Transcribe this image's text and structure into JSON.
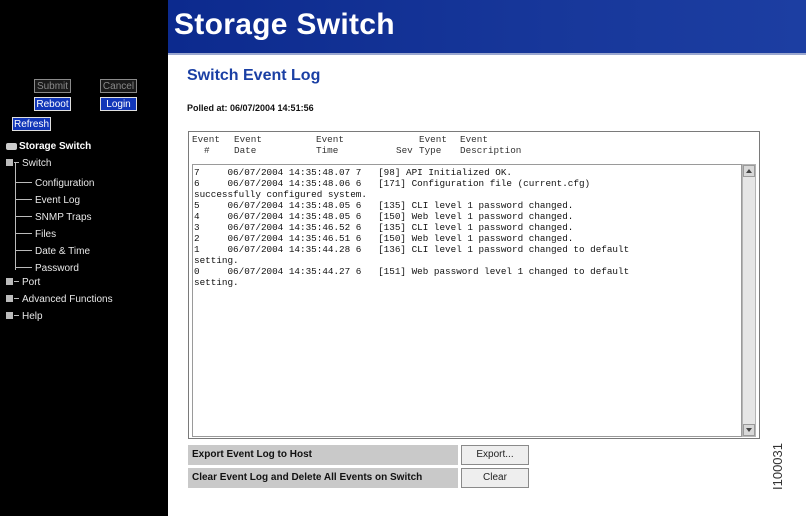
{
  "app": {
    "title": "Storage Switch"
  },
  "sidebar": {
    "buttons": {
      "submit": "Submit",
      "cancel": "Cancel",
      "reboot": "Reboot",
      "login": "Login",
      "refresh": "Refresh"
    },
    "tree": {
      "root": "Storage Switch",
      "switch": "Switch",
      "switch_children": [
        "Configuration",
        "Event Log",
        "SNMP Traps",
        "Files",
        "Date & Time",
        "Password"
      ],
      "port": "Port",
      "advanced": "Advanced Functions",
      "help": "Help"
    }
  },
  "main": {
    "title": "Switch Event Log",
    "polled": "Polled at: 06/07/2004 14:51:56",
    "log": {
      "headers": {
        "event_num_1": "Event",
        "event_num_2": "#",
        "event_date_1": "Event",
        "event_date_2": "Date",
        "event_time_1": "Event",
        "event_time_2": "Time",
        "sev": "Sev",
        "event_type_1": "Event",
        "event_type_2": "Type",
        "event_desc_1": "Event",
        "event_desc_2": "Description"
      },
      "lines": [
        "7     06/07/2004 14:35:48.07 7   [98] API Initialized OK.",
        "6     06/07/2004 14:35:48.06 6   [171] Configuration file (current.cfg)",
        "successfully configured system.",
        "5     06/07/2004 14:35:48.05 6   [135] CLI level 1 password changed.",
        "4     06/07/2004 14:35:48.05 6   [150] Web level 1 password changed.",
        "3     06/07/2004 14:35:46.52 6   [135] CLI level 1 password changed.",
        "2     06/07/2004 14:35:46.51 6   [150] Web level 1 password changed.",
        "1     06/07/2004 14:35:44.28 6   [136] CLI level 1 password changed to default",
        "setting.",
        "0     06/07/2004 14:35:44.27 6   [151] Web password level 1 changed to default",
        "setting."
      ]
    },
    "actions": {
      "export_label": "Export Event Log to Host",
      "export_button": "Export...",
      "clear_label": "Clear Event Log and Delete All Events on Switch",
      "clear_button": "Clear"
    }
  },
  "figure_id": "I100031"
}
